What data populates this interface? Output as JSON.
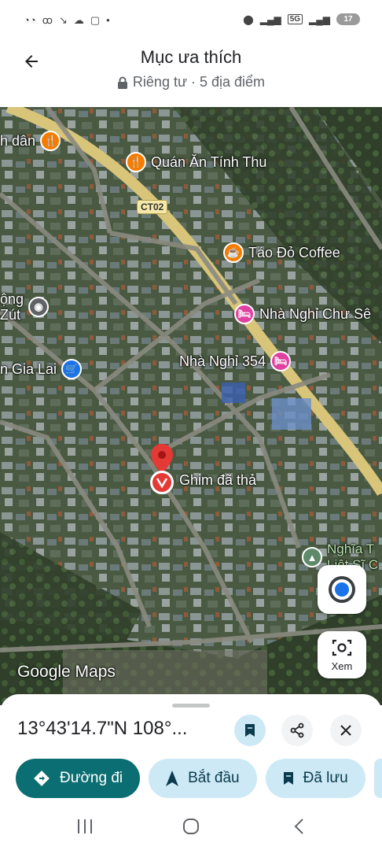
{
  "status_bar": {
    "time": "",
    "network": "5G",
    "battery": "17"
  },
  "header": {
    "title": "Mục ưa thích",
    "subtitle": "Riêng tư · 5 địa điểm"
  },
  "map": {
    "road_tag": "CT02",
    "places": [
      {
        "name": "h dân",
        "icon": "restaurant-icon",
        "color": "#f57c00"
      },
      {
        "name": "Quán Ăn Tính Thu",
        "icon": "restaurant-icon",
        "color": "#f57c00"
      },
      {
        "name": "Táo Đỏ Coffee",
        "icon": "coffee-icon",
        "color": "#f57c00"
      },
      {
        "name": "ộng\nZút",
        "icon": "place-icon",
        "color": "#5f6368"
      },
      {
        "name": "Nhà Nghỉ Chư Sê",
        "icon": "bed-icon",
        "color": "#e040a0"
      },
      {
        "name": "Nhà Nghỉ 354",
        "icon": "bed-icon",
        "color": "#e040a0"
      },
      {
        "name": "n Gia Lai",
        "icon": "shopping-cart-icon",
        "color": "#1a73e8"
      },
      {
        "name": "Nghĩa T\nLiệt Sĩ C",
        "icon": "monument-icon",
        "color": "#5f8a6a"
      }
    ],
    "dropped_pin_label": "Ghim đã thả",
    "logo": "Google Maps",
    "view_button_label": "Xem"
  },
  "sheet": {
    "coordinates": "13°43'14.7\"N 108°...",
    "actions": [
      {
        "label": "Đường đi",
        "icon": "directions-icon"
      },
      {
        "label": "Bắt đầu",
        "icon": "navigation-arrow-icon"
      },
      {
        "label": "Đã lưu",
        "icon": "bookmark-icon"
      }
    ]
  },
  "colors": {
    "primary": "#0b6e72",
    "tonal": "#cde9f6",
    "pin": "#e53935",
    "location_blue": "#1a73e8"
  }
}
